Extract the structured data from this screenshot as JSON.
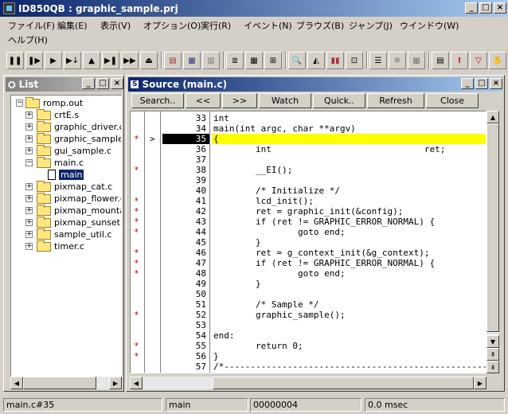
{
  "window": {
    "title": "ID850QB : graphic_sample.prj"
  },
  "menu": [
    "ファイル(F)",
    "編集(E)",
    "表示(V)",
    "オプション(O)",
    "実行(R)",
    "イベント(N)",
    "ブラウズ(B)",
    "ジャンプ(J)",
    "ウインドウ(W)",
    "ヘルプ(H)"
  ],
  "list_panel": {
    "title": "List",
    "tree": [
      "romp.out",
      "crtE.s",
      "graphic_driver.c",
      "graphic_sample.c",
      "gui_sample.c",
      "main.c",
      "main",
      "pixmap_cat.c",
      "pixmap_flower.c",
      "pixmap_mountain.c",
      "pixmap_sunset.c",
      "sample_util.c",
      "timer.c"
    ]
  },
  "source_panel": {
    "title": "Source (main.c)",
    "buttons": [
      "Search..",
      "<<",
      ">>",
      "Watch",
      "Quick..",
      "Refresh",
      "Close"
    ],
    "lines": [
      {
        "n": "33",
        "code": "int",
        "mark": ""
      },
      {
        "n": "34",
        "code": "main(int argc, char **argv)",
        "mark": ""
      },
      {
        "n": "35",
        "code": "{",
        "mark": "*"
      },
      {
        "n": "36",
        "code": "        int                             ret;",
        "mark": ""
      },
      {
        "n": "37",
        "code": "",
        "mark": ""
      },
      {
        "n": "38",
        "code": "        __EI();",
        "mark": "*"
      },
      {
        "n": "39",
        "code": "",
        "mark": ""
      },
      {
        "n": "40",
        "code": "        /* Initialize */",
        "mark": ""
      },
      {
        "n": "41",
        "code": "        lcd_init();",
        "mark": "*"
      },
      {
        "n": "42",
        "code": "        ret = graphic_init(&config);",
        "mark": "*"
      },
      {
        "n": "43",
        "code": "        if (ret != GRAPHIC_ERROR_NORMAL) {",
        "mark": "*"
      },
      {
        "n": "44",
        "code": "                goto end;",
        "mark": "*"
      },
      {
        "n": "45",
        "code": "        }",
        "mark": ""
      },
      {
        "n": "46",
        "code": "        ret = g_context_init(&g_context);",
        "mark": "*"
      },
      {
        "n": "47",
        "code": "        if (ret != GRAPHIC_ERROR_NORMAL) {",
        "mark": "*"
      },
      {
        "n": "48",
        "code": "                goto end;",
        "mark": "*"
      },
      {
        "n": "49",
        "code": "        }",
        "mark": ""
      },
      {
        "n": "50",
        "code": "",
        "mark": ""
      },
      {
        "n": "51",
        "code": "        /* Sample */",
        "mark": ""
      },
      {
        "n": "52",
        "code": "        graphic_sample();",
        "mark": "*"
      },
      {
        "n": "53",
        "code": "",
        "mark": ""
      },
      {
        "n": "54",
        "code": "end:",
        "mark": ""
      },
      {
        "n": "55",
        "code": "        return 0;",
        "mark": "*"
      },
      {
        "n": "56",
        "code": "}",
        "mark": "*"
      },
      {
        "n": "57",
        "code": "/*-----------------------------------------------------",
        "mark": ""
      }
    ],
    "current_line": "35",
    "current_arrow": ">"
  },
  "status": {
    "location": "main.c#35",
    "function": "main",
    "address": "00000004",
    "time": "0.0 msec"
  },
  "colors": {
    "highlight": "#ffff00",
    "pc_bg": "#000000",
    "title_active": "#0a246a"
  }
}
